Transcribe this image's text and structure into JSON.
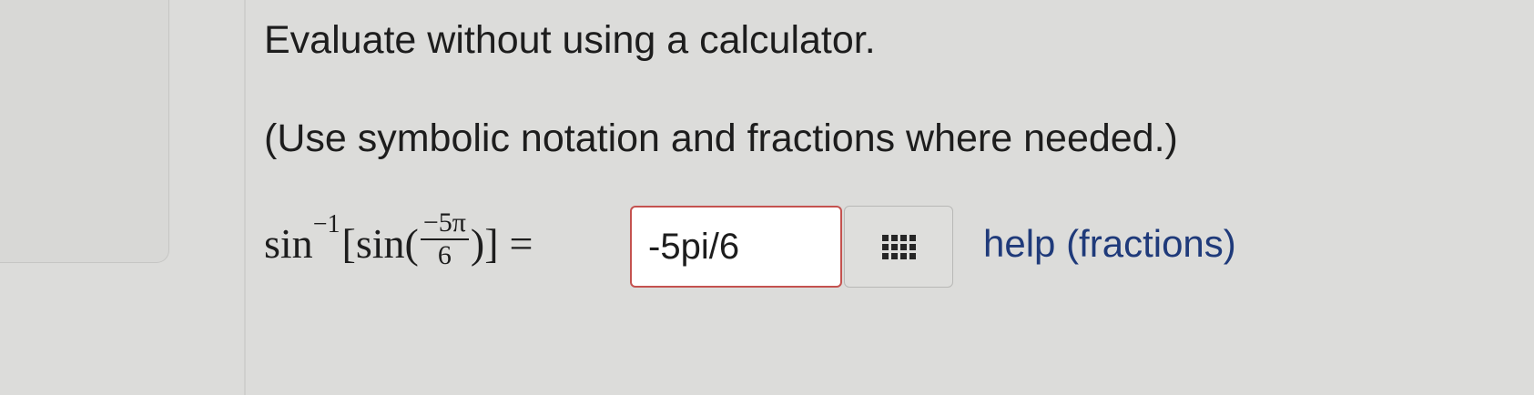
{
  "question": {
    "instruction": "Evaluate without using a calculator.",
    "hint": "(Use symbolic notation and fractions where needed.)",
    "expression": {
      "outer_fn": "sin",
      "exponent": "−1",
      "open_bracket": "[",
      "inner_fn": "sin(",
      "numerator": "−5π",
      "denominator": "6",
      "close_bracket": ")]",
      "equals": "="
    },
    "answer_value": "-5pi/6",
    "palette_icon": "grid-keypad-icon",
    "help_link": "help (fractions)"
  },
  "colors": {
    "input_border": "#c4524f",
    "link": "#1f3a7a",
    "background": "#dcdcda"
  }
}
